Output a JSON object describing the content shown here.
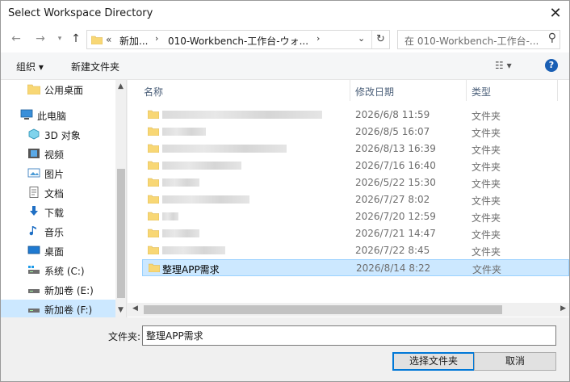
{
  "window": {
    "title": "Select Workspace Directory"
  },
  "address": {
    "chevrons": "«",
    "crumbs": [
      "新加...",
      "010-Workbench-工作台-ウォ..."
    ],
    "search_placeholder": "在 010-Workbench-工作台-..."
  },
  "toolbar": {
    "organize": "组织 ▾",
    "new_folder": "新建文件夹",
    "help": "?"
  },
  "nav": {
    "items": [
      {
        "label": "公用桌面",
        "icon": "folder-icon"
      },
      {
        "label": "此电脑",
        "icon": "computer-icon"
      },
      {
        "label": "3D 对象",
        "icon": "3d-objects-icon"
      },
      {
        "label": "视频",
        "icon": "video-icon"
      },
      {
        "label": "图片",
        "icon": "pictures-icon"
      },
      {
        "label": "文档",
        "icon": "documents-icon"
      },
      {
        "label": "下载",
        "icon": "download-icon"
      },
      {
        "label": "音乐",
        "icon": "music-icon"
      },
      {
        "label": "桌面",
        "icon": "desktop-icon"
      },
      {
        "label": "系统 (C:)",
        "icon": "drive-icon"
      },
      {
        "label": "新加卷 (E:)",
        "icon": "drive-icon"
      },
      {
        "label": "新加卷 (F:)",
        "icon": "drive-icon"
      }
    ]
  },
  "list": {
    "columns": {
      "name": "名称",
      "modified": "修改日期",
      "type": "类型"
    },
    "rows": [
      {
        "name": "",
        "date": "2026/6/8 11:59",
        "type": "文件夹"
      },
      {
        "name": "",
        "date": "2026/8/5 16:07",
        "type": "文件夹"
      },
      {
        "name": "",
        "date": "2026/8/13 16:39",
        "type": "文件夹"
      },
      {
        "name": "",
        "date": "2026/7/16 16:40",
        "type": "文件夹"
      },
      {
        "name": "",
        "date": "2026/5/22 15:30",
        "type": "文件夹"
      },
      {
        "name": "",
        "date": "2026/7/27 8:02",
        "type": "文件夹"
      },
      {
        "name": "",
        "date": "2026/7/20 12:59",
        "type": "文件夹"
      },
      {
        "name": "",
        "date": "2026/7/21 14:47",
        "type": "文件夹"
      },
      {
        "name": "",
        "date": "2026/7/22 8:45",
        "type": "文件夹"
      },
      {
        "name": "整理APP需求",
        "date": "2026/8/14 8:22",
        "type": "文件夹"
      }
    ]
  },
  "footer": {
    "folder_label": "文件夹:",
    "folder_value": "整理APP需求",
    "select_button": "选择文件夹",
    "cancel_button": "取消"
  },
  "colors": {
    "selection": "#cce8ff",
    "accent": "#0078d7",
    "folder": "#f8d775"
  }
}
